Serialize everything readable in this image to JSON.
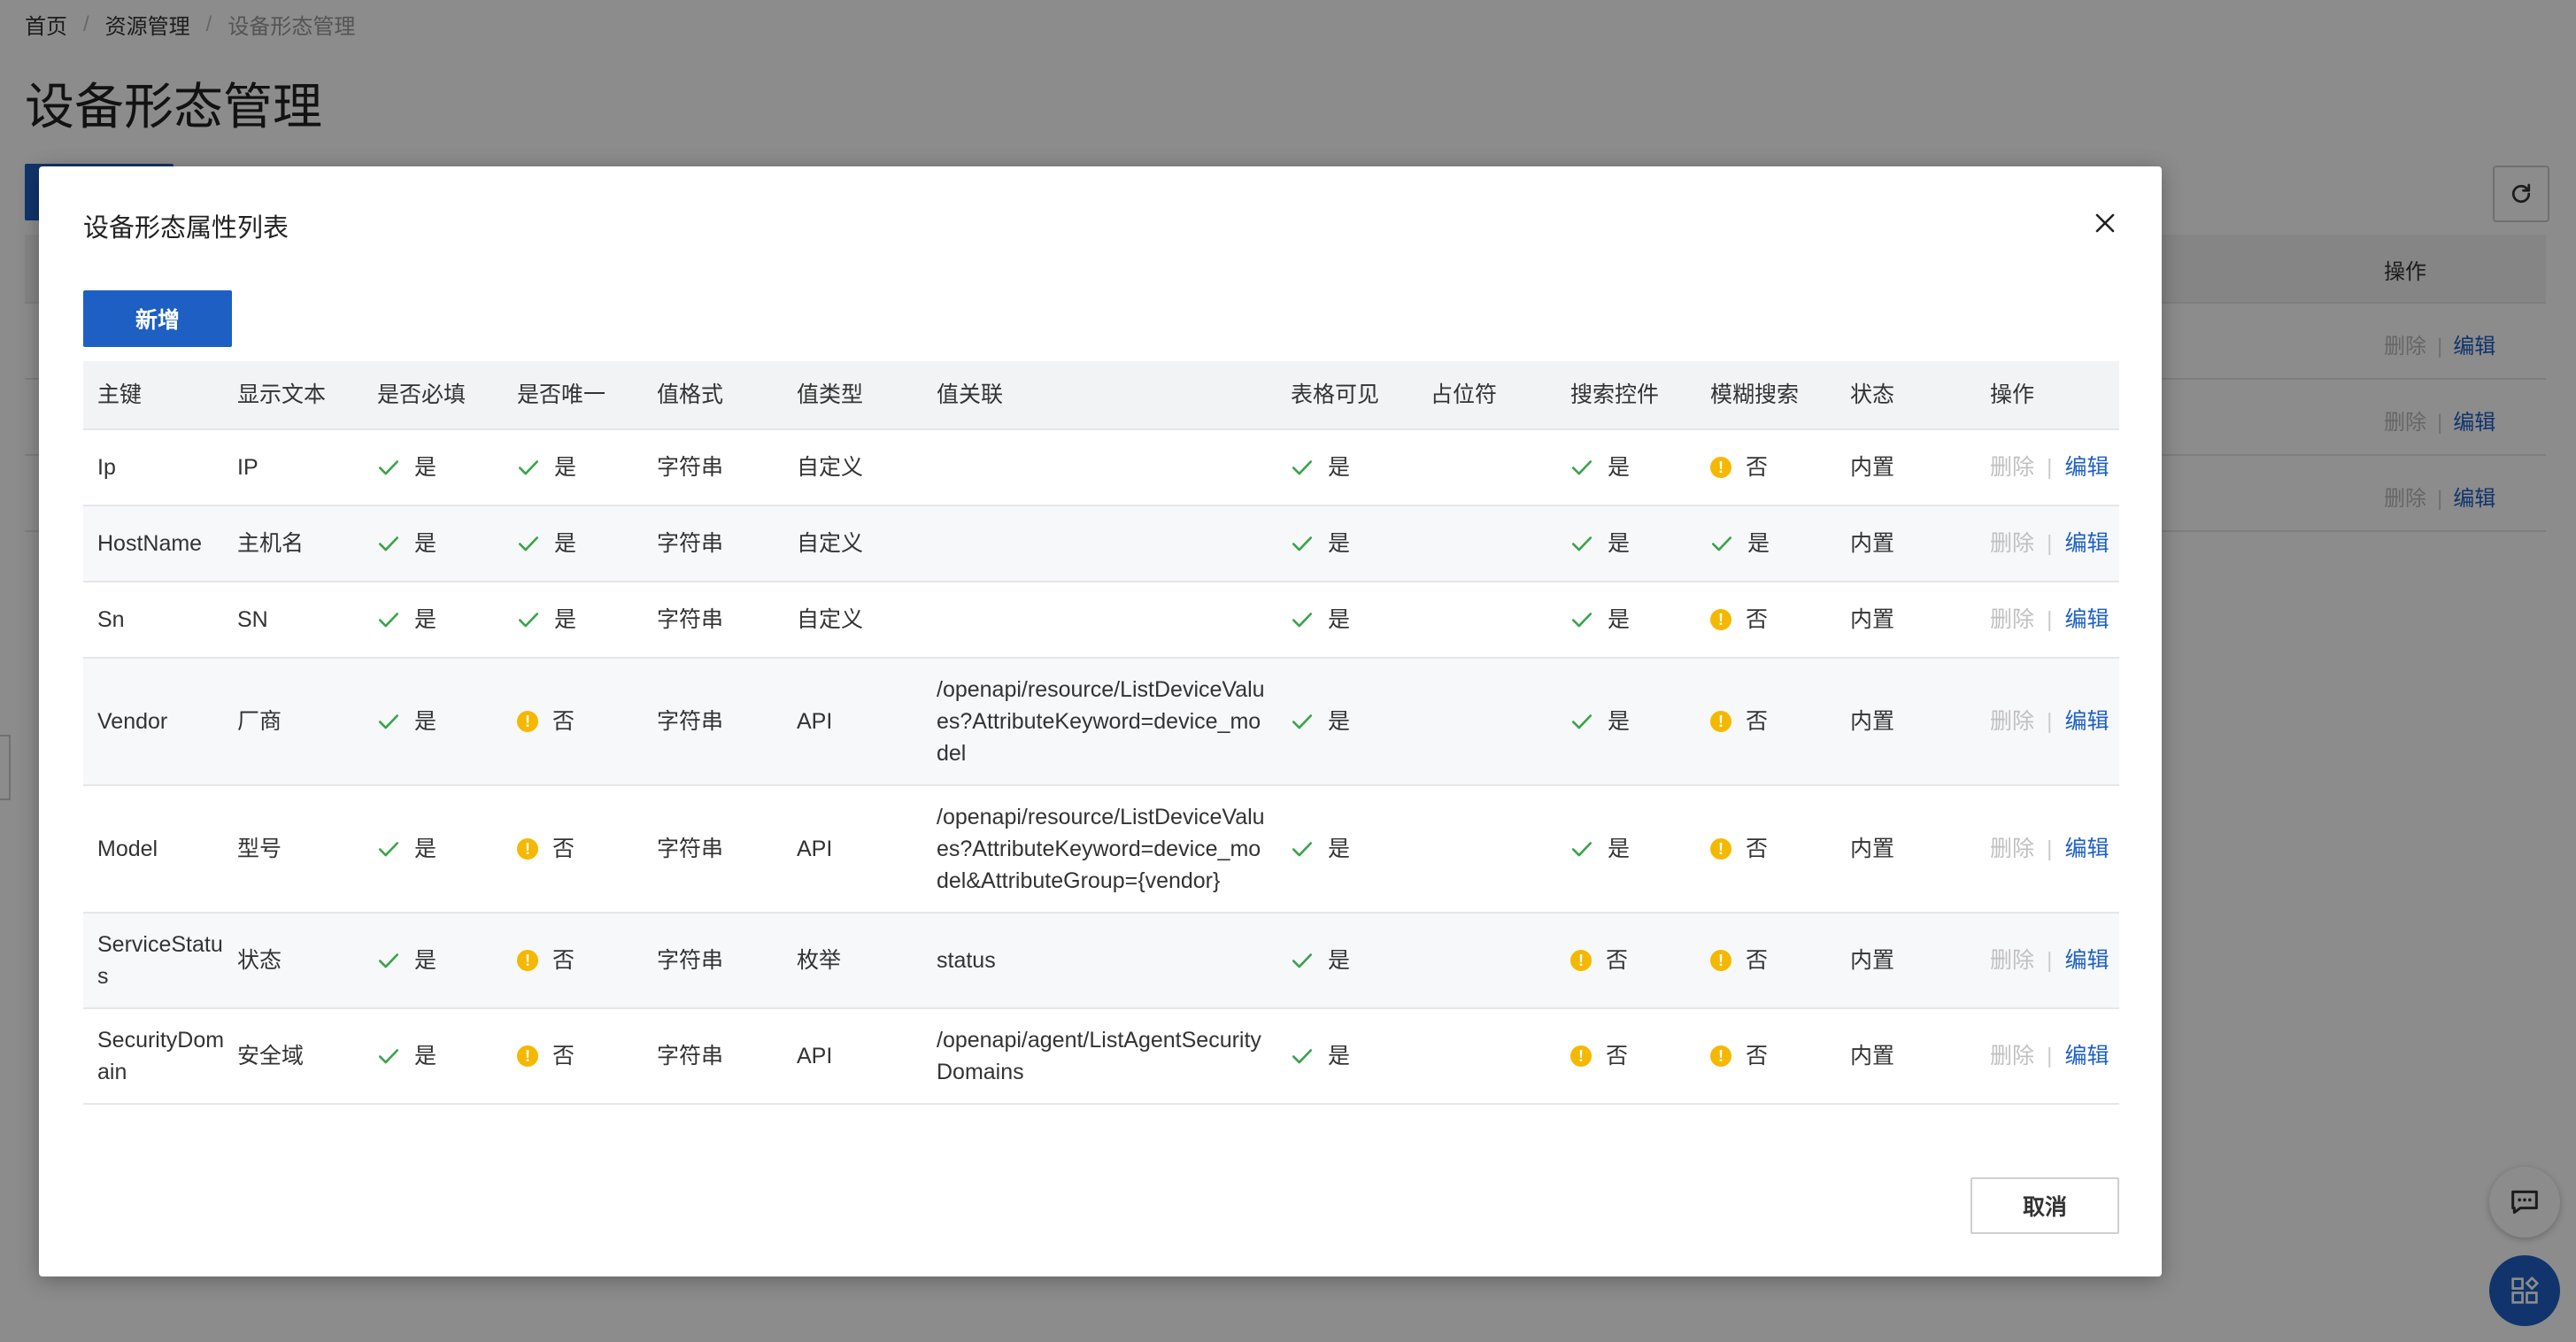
{
  "background": {
    "breadcrumb": [
      "首页",
      "资源管理",
      "设备形态管理"
    ],
    "title": "设备形态管理",
    "table_op_header": "操作",
    "rows": [
      {
        "delete": "删除",
        "edit": "编辑"
      },
      {
        "delete": "删除",
        "edit": "编辑"
      },
      {
        "delete": "删除",
        "edit": "编辑"
      }
    ]
  },
  "modal": {
    "title": "设备形态属性列表",
    "add_label": "新增",
    "cancel_label": "取消",
    "columns": [
      "主键",
      "显示文本",
      "是否必填",
      "是否唯一",
      "值格式",
      "值类型",
      "值关联",
      "表格可见",
      "占位符",
      "搜索控件",
      "模糊搜索",
      "状态",
      "操作"
    ],
    "rows": [
      {
        "key": "Ip",
        "label": "IP",
        "required": "是",
        "unique": "是",
        "format": "字符串",
        "type": "自定义",
        "relation": "",
        "visible": "是",
        "placeholder": "",
        "search": "是",
        "fuzzy": "否",
        "status": "内置",
        "delete": "删除",
        "edit": "编辑"
      },
      {
        "key": "HostName",
        "label": "主机名",
        "required": "是",
        "unique": "是",
        "format": "字符串",
        "type": "自定义",
        "relation": "",
        "visible": "是",
        "placeholder": "",
        "search": "是",
        "fuzzy": "是",
        "status": "内置",
        "delete": "删除",
        "edit": "编辑"
      },
      {
        "key": "Sn",
        "label": "SN",
        "required": "是",
        "unique": "是",
        "format": "字符串",
        "type": "自定义",
        "relation": "",
        "visible": "是",
        "placeholder": "",
        "search": "是",
        "fuzzy": "否",
        "status": "内置",
        "delete": "删除",
        "edit": "编辑"
      },
      {
        "key": "Vendor",
        "label": "厂商",
        "required": "是",
        "unique": "否",
        "format": "字符串",
        "type": "API",
        "relation": "/openapi/resource/ListDeviceValues?AttributeKeyword=device_model",
        "visible": "是",
        "placeholder": "",
        "search": "是",
        "fuzzy": "否",
        "status": "内置",
        "delete": "删除",
        "edit": "编辑"
      },
      {
        "key": "Model",
        "label": "型号",
        "required": "是",
        "unique": "否",
        "format": "字符串",
        "type": "API",
        "relation": "/openapi/resource/ListDeviceValues?AttributeKeyword=device_model&AttributeGroup={vendor}",
        "visible": "是",
        "placeholder": "",
        "search": "是",
        "fuzzy": "否",
        "status": "内置",
        "delete": "删除",
        "edit": "编辑"
      },
      {
        "key": "ServiceStatus",
        "label": "状态",
        "required": "是",
        "unique": "否",
        "format": "字符串",
        "type": "枚举",
        "relation": "status",
        "visible": "是",
        "placeholder": "",
        "search": "否",
        "fuzzy": "否",
        "status": "内置",
        "delete": "删除",
        "edit": "编辑"
      },
      {
        "key": "SecurityDomain",
        "label": "安全域",
        "required": "是",
        "unique": "否",
        "format": "字符串",
        "type": "API",
        "relation": "/openapi/agent/ListAgentSecurityDomains",
        "visible": "是",
        "placeholder": "",
        "search": "否",
        "fuzzy": "否",
        "status": "内置",
        "delete": "删除",
        "edit": "编辑"
      }
    ]
  },
  "colors": {
    "primary": "#1e5fc3",
    "check": "#3aa34a",
    "warn": "#f5b800"
  },
  "icons": {
    "yes": "check-icon",
    "no": "warning-icon",
    "close": "close-icon",
    "refresh": "refresh-icon",
    "chat": "chat-icon",
    "apps": "apps-icon"
  }
}
